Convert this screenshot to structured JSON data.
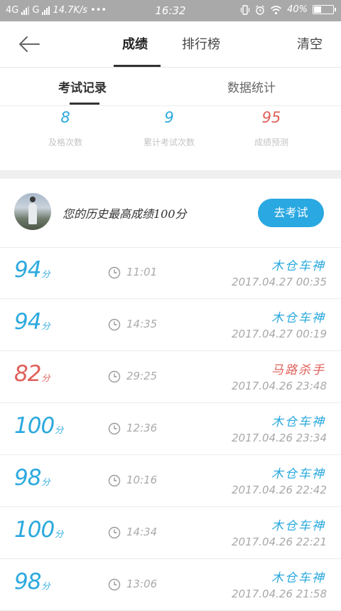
{
  "status_bar": {
    "network1": "4G",
    "network2": "G",
    "speed": "14.7K/s",
    "dots": "•••",
    "time": "16:32",
    "battery": "40%",
    "battery_level": 0.4
  },
  "header": {
    "tab_score": "成绩",
    "tab_rank": "排行榜",
    "clear": "清空"
  },
  "subtabs": {
    "exam_records": "考试记录",
    "data_stats": "数据统计"
  },
  "stats": [
    {
      "value": "8",
      "label": "及格次数",
      "color": "#2ba9de"
    },
    {
      "value": "9",
      "label": "累计考试次数",
      "color": "#2ba9de"
    },
    {
      "value": "95",
      "label": "成绩预测",
      "color": "#e0605a"
    }
  ],
  "best": {
    "text": "您的历史最高成绩100分",
    "button": "去考试"
  },
  "records": [
    {
      "score": "94",
      "unit": "分",
      "duration": "11:01",
      "title": "木仓车神",
      "date": "2017.04.27  00:35",
      "color": "blue"
    },
    {
      "score": "94",
      "unit": "分",
      "duration": "14:35",
      "title": "木仓车神",
      "date": "2017.04.27  00:19",
      "color": "blue"
    },
    {
      "score": "82",
      "unit": "分",
      "duration": "29:25",
      "title": "马路杀手",
      "date": "2017.04.26  23:48",
      "color": "red"
    },
    {
      "score": "100",
      "unit": "分",
      "duration": "12:36",
      "title": "木仓车神",
      "date": "2017.04.26  23:34",
      "color": "blue"
    },
    {
      "score": "98",
      "unit": "分",
      "duration": "10:16",
      "title": "木仓车神",
      "date": "2017.04.26  22:42",
      "color": "blue"
    },
    {
      "score": "100",
      "unit": "分",
      "duration": "14:34",
      "title": "木仓车神",
      "date": "2017.04.26  22:21",
      "color": "blue"
    },
    {
      "score": "98",
      "unit": "分",
      "duration": "13:06",
      "title": "木仓车神",
      "date": "2017.04.26  21:58",
      "color": "blue"
    }
  ]
}
